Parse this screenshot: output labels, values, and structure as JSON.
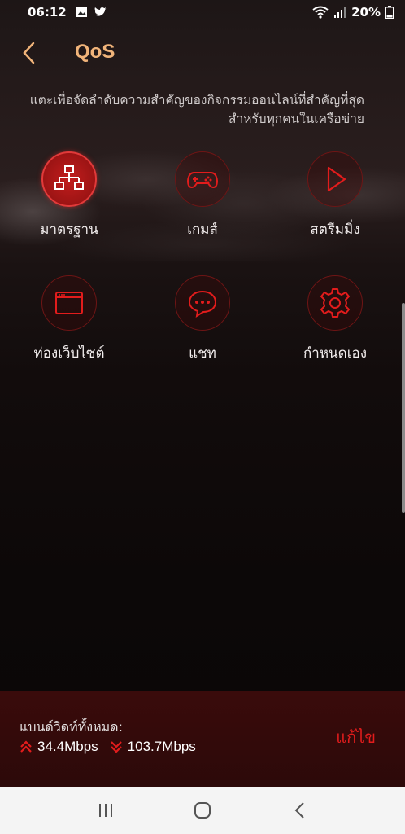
{
  "status_bar": {
    "time": "06:12",
    "battery": "20%"
  },
  "header": {
    "title": "QoS"
  },
  "description": "แตะเพื่อจัดลำดับความสำคัญของกิจกรรมออนไลน์ที่สำคัญที่สุดสำหรับทุกคนในเครือข่าย",
  "modes": [
    {
      "label": "มาตรฐาน",
      "icon": "network-icon",
      "active": true
    },
    {
      "label": "เกมส์",
      "icon": "gamepad-icon",
      "active": false
    },
    {
      "label": "สตรีมมิ่ง",
      "icon": "play-icon",
      "active": false
    },
    {
      "label": "ท่องเว็บไซต์",
      "icon": "browser-icon",
      "active": false
    },
    {
      "label": "แชท",
      "icon": "chat-icon",
      "active": false
    },
    {
      "label": "กำหนดเอง",
      "icon": "gear-icon",
      "active": false
    }
  ],
  "bandwidth": {
    "label": "แบนด์วิดท์ทั้งหมด:",
    "upload": "34.4Mbps",
    "download": "103.7Mbps",
    "edit_label": "แก้ไข"
  },
  "colors": {
    "accent": "#e21c1c",
    "title": "#f1b47a"
  }
}
